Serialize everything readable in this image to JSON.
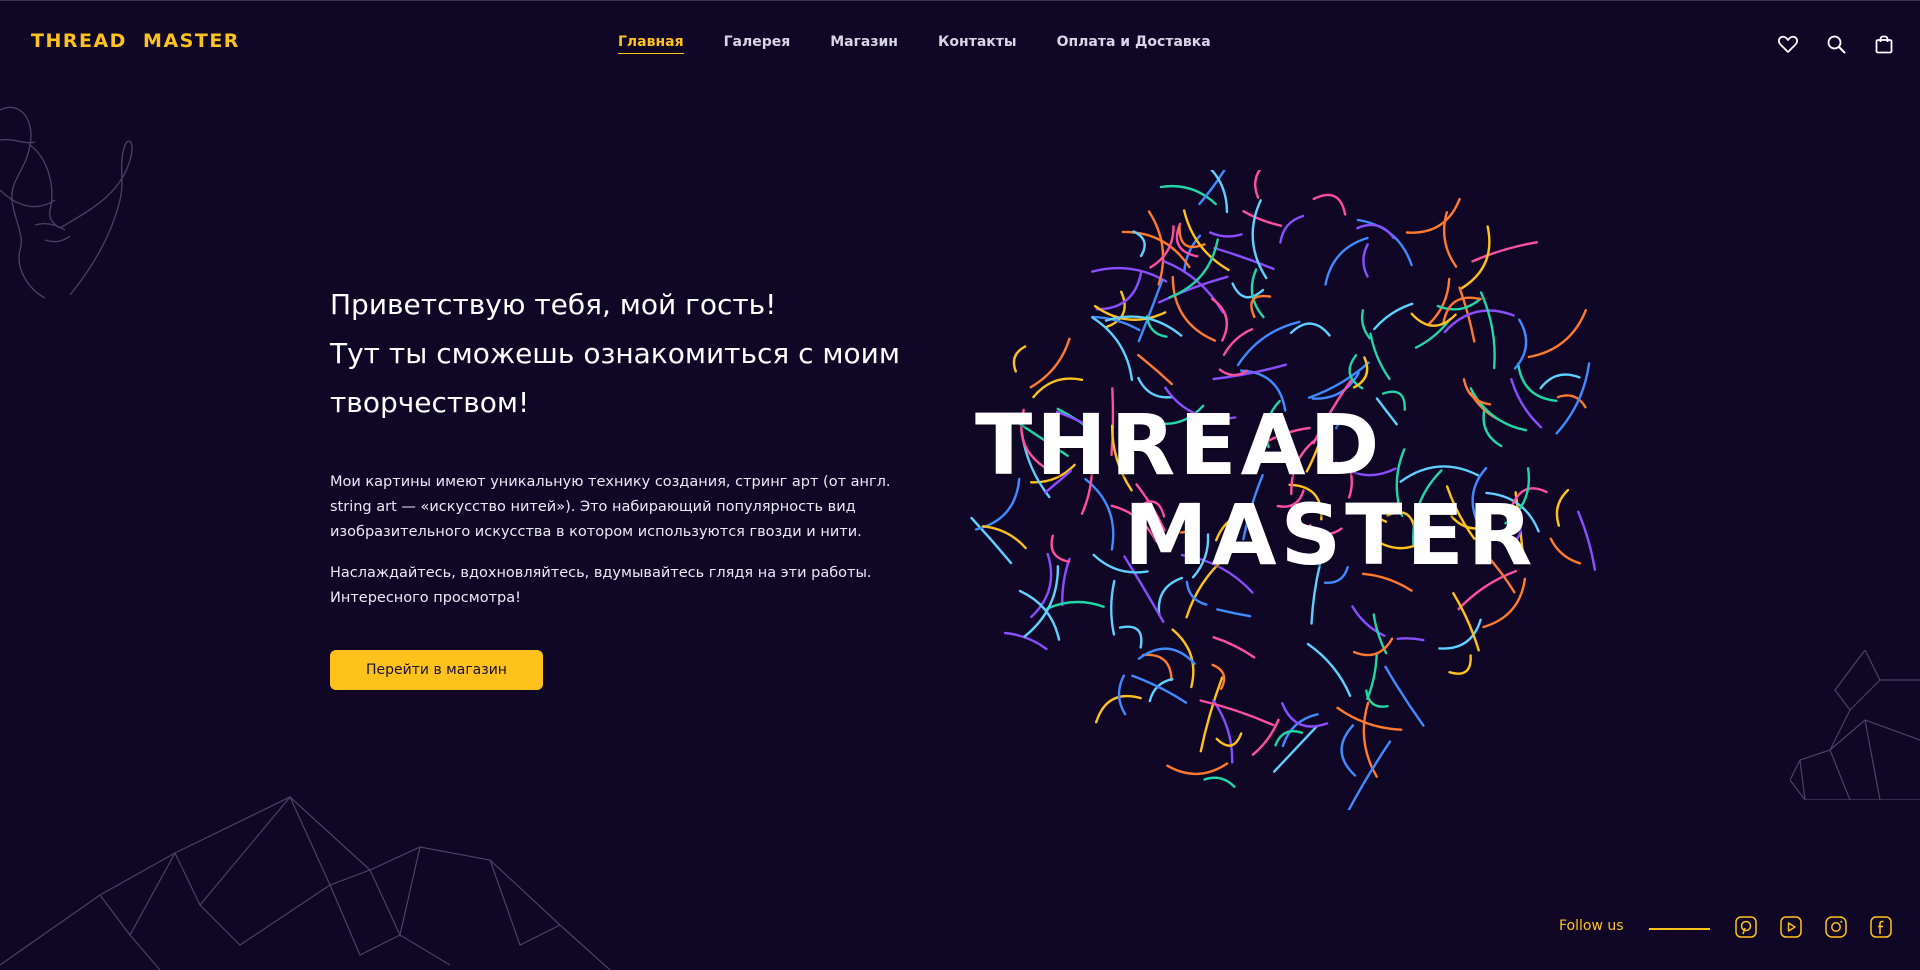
{
  "header": {
    "logo": "THREAD MASTER",
    "nav": [
      {
        "label": "Главная",
        "active": true
      },
      {
        "label": "Галерея",
        "active": false
      },
      {
        "label": "Магазин",
        "active": false
      },
      {
        "label": "Контакты",
        "active": false
      },
      {
        "label": "Оплата и Доставка",
        "active": false
      }
    ],
    "icons": [
      "heart-icon",
      "search-icon",
      "shopping-bag-icon"
    ]
  },
  "hero": {
    "title_lines": [
      "Приветствую тебя, мой гость!",
      "Тут ты сможешь ознакомиться с моим",
      "творчеством!"
    ],
    "paragraph1_lines": [
      "Мои картины имеют уникальную технику создания, стринг арт (от англ.",
      "string art — «искусство нитей»). Это набирающий популярность вид",
      "изобразительного искусства в котором используются гвозди и нити."
    ],
    "paragraph2_lines": [
      "Наслаждайтесь, вдохновляйтесь, вдумывайтесь глядя на эти работы.",
      "Интересного просмотра!"
    ],
    "button_label": "Перейти в магазин"
  },
  "art": {
    "title_line1": "THREAD",
    "title_line2": "MASTER",
    "thread_colors": [
      "#ffc21c",
      "#ff4fa0",
      "#3f8bff",
      "#8a4dff",
      "#22d6a6",
      "#ff7a2f",
      "#5fd0ff"
    ]
  },
  "footer": {
    "follow_label": "Follow us",
    "social_icons": [
      "pinterest-icon",
      "youtube-icon",
      "instagram-icon",
      "facebook-icon"
    ]
  },
  "colors": {
    "background": "#100727",
    "accent": "#ffc21c",
    "text": "#ffffff",
    "line_art": "#4a4266"
  }
}
